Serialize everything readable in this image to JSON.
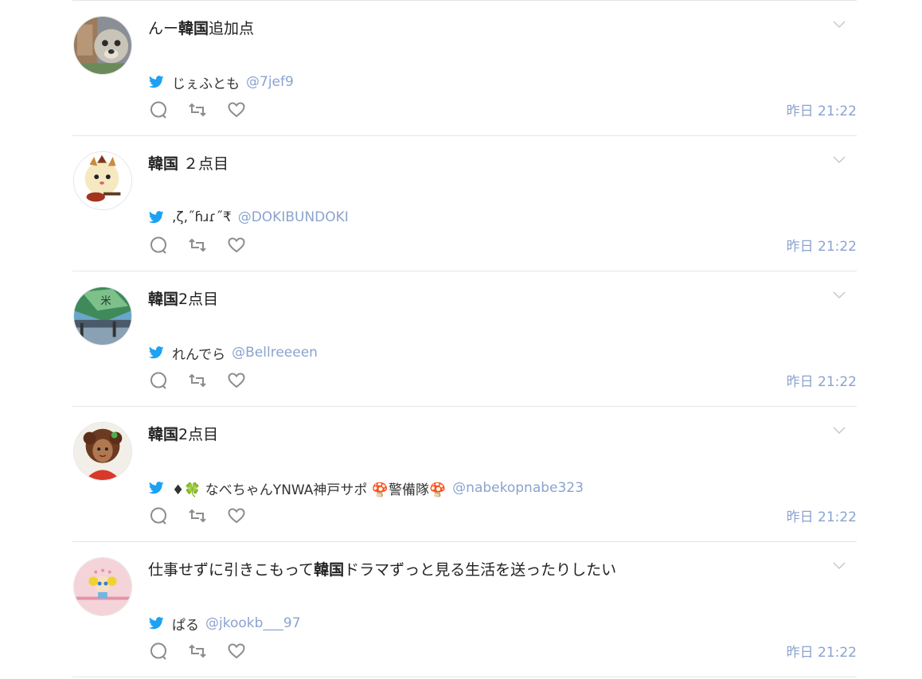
{
  "tweets": [
    {
      "text_before": "んー",
      "keyword": "韓国",
      "text_after": "追加点",
      "name": "じぇふとも",
      "handle": "@7jef9",
      "time": "昨日 21:22"
    },
    {
      "text_before": "",
      "keyword": "韓国",
      "text_after": " ２点目",
      "name": ",ζ,˝ɦɹɾ˝₹",
      "handle": "@DOKIBUNDOKI",
      "time": "昨日 21:22"
    },
    {
      "text_before": "",
      "keyword": "韓国",
      "text_after": "2点目",
      "name": "れんでら",
      "handle": "@Bellreeeen",
      "time": "昨日 21:22"
    },
    {
      "text_before": "",
      "keyword": "韓国",
      "text_after": "2点目",
      "name": "♦🍀 なべちゃんYNWA神戸サポ 🍄警備隊🍄",
      "handle": "@nabekopnabe323",
      "time": "昨日 21:22"
    },
    {
      "text_before": "仕事せずに引きこもって",
      "keyword": "韓国",
      "text_after": "ドラマずっと見る生活を送ったりしたい",
      "name": "ぱる",
      "handle": "@jkookb___97",
      "time": "昨日 21:22"
    }
  ],
  "icons": {
    "menu": "chevron-down-icon",
    "source": "twitter-bird-icon",
    "reply": "reply-icon",
    "retweet": "retweet-icon",
    "like": "heart-icon"
  },
  "colors": {
    "link": "#8aa3cf",
    "bird": "#1da1f2",
    "icon": "#8c8c8c",
    "divider": "#e3e6e8"
  }
}
